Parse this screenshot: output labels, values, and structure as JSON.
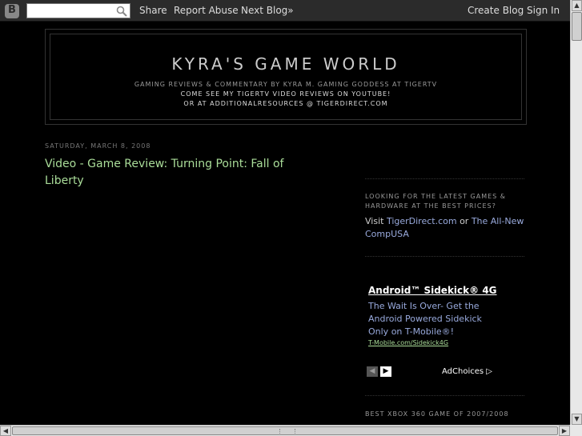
{
  "navbar": {
    "logo_letter": "B",
    "search_placeholder": "",
    "share_label": "Share",
    "report_label": "Report Abuse",
    "next_blog_label": "Next Blog»",
    "create_blog_label": "Create Blog",
    "sign_in_label": "Sign In"
  },
  "header": {
    "title": "KYRA'S GAME WORLD",
    "desc_line1": "GAMING REVIEWS & COMMENTARY BY KYRA M. GAMING GODDESS AT TIGERTV",
    "desc_line2": "COME SEE MY TIGERTV VIDEO REVIEWS ON YOUTUBE!",
    "desc_line3": "OR AT ADDITIONALRESOURCES @ TIGERDIRECT.COM"
  },
  "post": {
    "date": "SATURDAY, MARCH 8, 2008",
    "title": "Video - Game Review: Turning Point: Fall of Liberty"
  },
  "sidebar": {
    "widget1_heading": "LOOKING FOR THE LATEST GAMES & HARDWARE AT THE BEST PRICES?",
    "visit_text": "Visit ",
    "link1": "TigerDirect.com",
    "or_text": " or ",
    "link2": "The All-New CompUSA",
    "ad": {
      "title": "Android™ Sidekick® 4G",
      "body": "The Wait Is Over- Get the Android Powered Sidekick Only on T-Mobile®!",
      "url": "T-Mobile.com/Sidekick4G",
      "prev": "◀",
      "next": "▶",
      "adchoices": "AdChoices ▷"
    },
    "widget3_heading": "BEST XBOX 360 GAME OF 2007/2008"
  }
}
